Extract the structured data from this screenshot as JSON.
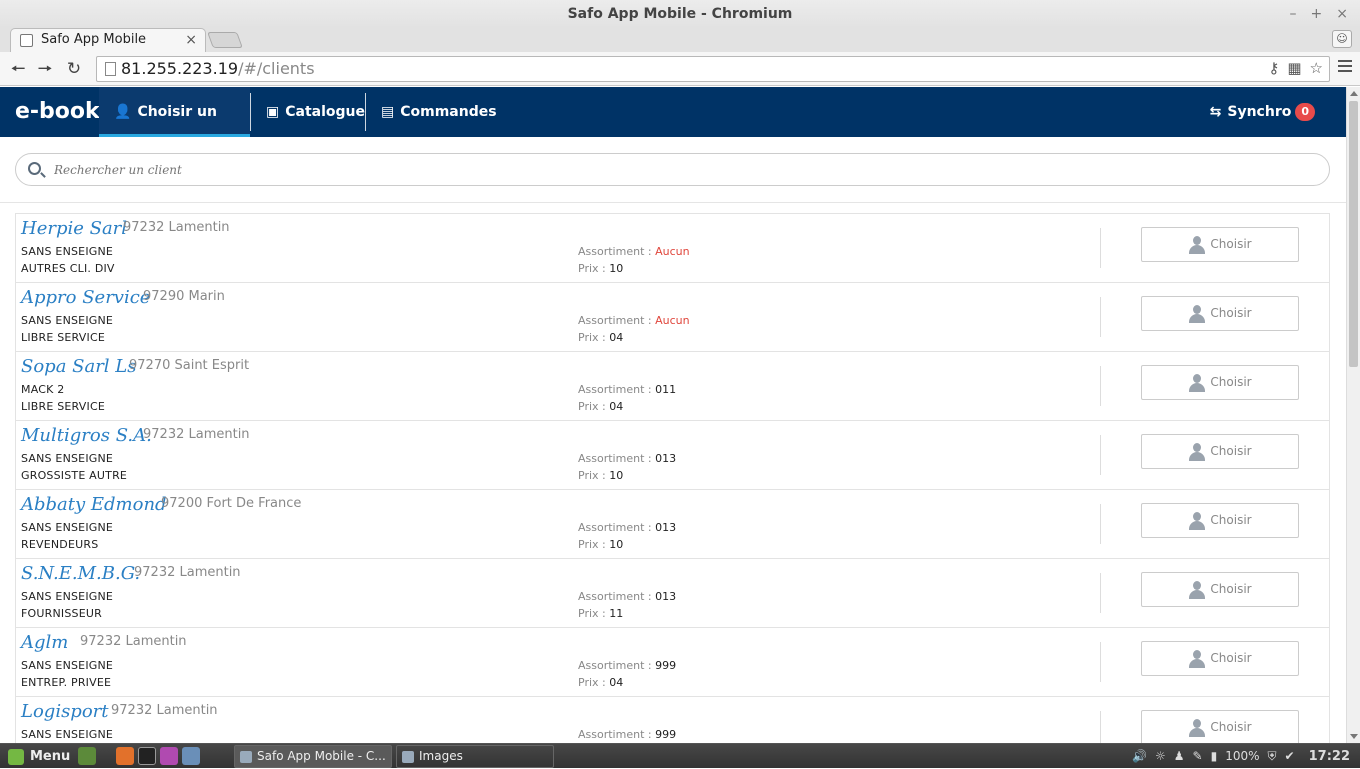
{
  "window": {
    "title": "Safo App Mobile - Chromium"
  },
  "browser": {
    "tab_title": "Safo App Mobile",
    "url_host": "81.255.223.19",
    "url_path": "/#/clients"
  },
  "navbar": {
    "brand": "e-book",
    "items": [
      {
        "label": "Choisir un client",
        "icon": "user-icon",
        "active": true
      },
      {
        "label": "Catalogue",
        "icon": "book-icon"
      },
      {
        "label": "Commandes",
        "icon": "list-icon"
      }
    ],
    "sync_label": "Synchro",
    "sync_count": "0"
  },
  "search": {
    "placeholder": "Rechercher un client"
  },
  "labels": {
    "assortiment": "Assortiment :",
    "prix": "Prix :",
    "choose": "Choisir"
  },
  "clients": [
    {
      "name": "Herpie Sarl",
      "city": "97232 Lamentin",
      "line1": "SANS ENSEIGNE",
      "line2": "AUTRES CLI. DIV",
      "assortiment": "Aucun",
      "prix": "10"
    },
    {
      "name": "Appro Service",
      "city": "97290 Marin",
      "line1": "SANS ENSEIGNE",
      "line2": "LIBRE SERVICE",
      "assortiment": "Aucun",
      "prix": "04"
    },
    {
      "name": "Sopa Sarl Ls",
      "city": "97270 Saint Esprit",
      "line1": "MACK 2",
      "line2": "LIBRE SERVICE",
      "assortiment": "011",
      "prix": "04"
    },
    {
      "name": "Multigros S.A.",
      "city": "97232 Lamentin",
      "line1": "SANS ENSEIGNE",
      "line2": "GROSSISTE AUTRE",
      "assortiment": "013",
      "prix": "10"
    },
    {
      "name": "Abbaty Edmond",
      "city": "97200 Fort De France",
      "line1": "SANS ENSEIGNE",
      "line2": "REVENDEURS",
      "assortiment": "013",
      "prix": "10"
    },
    {
      "name": "S.N.E.M.B.G.",
      "city": "97232 Lamentin",
      "line1": "SANS ENSEIGNE",
      "line2": "FOURNISSEUR",
      "assortiment": "013",
      "prix": "11"
    },
    {
      "name": "Aglm",
      "city": "97232 Lamentin",
      "line1": "SANS ENSEIGNE",
      "line2": "ENTREP. PRIVEE",
      "assortiment": "999",
      "prix": "04"
    },
    {
      "name": "Logisport",
      "city": "97232 Lamentin",
      "line1": "SANS ENSEIGNE",
      "line2": "",
      "assortiment": "999",
      "prix": ""
    }
  ],
  "taskbar": {
    "menu": "Menu",
    "windows": [
      "Safo App Mobile - C...",
      "Images"
    ],
    "battery": "100%",
    "clock": "17:22"
  },
  "colors": {
    "navbar": "#003366",
    "active_underline": "#29a8e0",
    "client_name": "#2a7fc4",
    "aucun": "#e0463c",
    "badge": "#e84b4b"
  }
}
